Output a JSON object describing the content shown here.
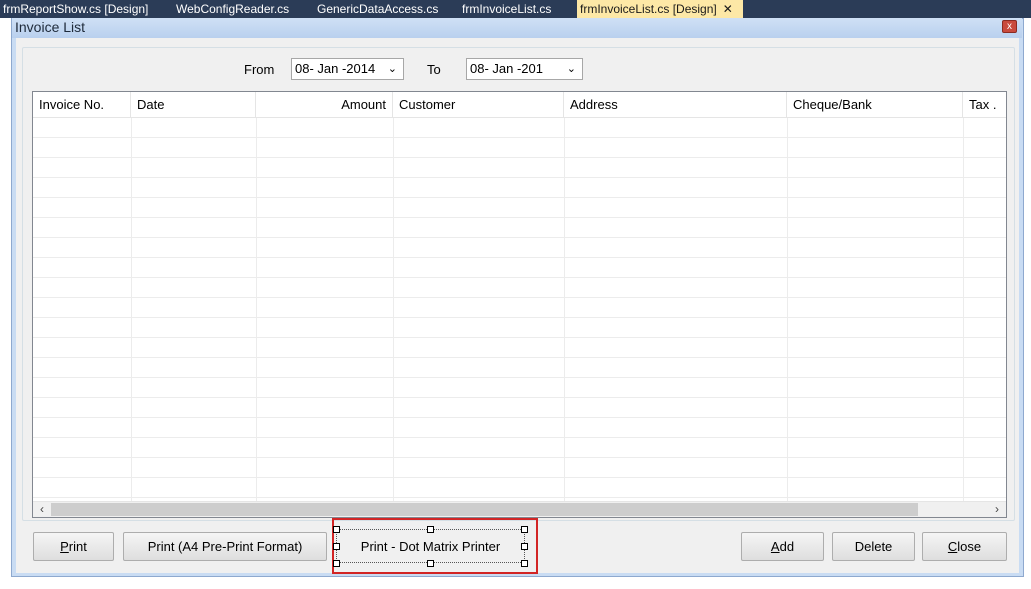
{
  "tabs": [
    {
      "label": "frmReportShow.cs [Design]",
      "active": false
    },
    {
      "label": "WebConfigReader.cs",
      "active": false
    },
    {
      "label": "GenericDataAccess.cs",
      "active": false
    },
    {
      "label": "frmInvoiceList.cs",
      "active": false
    },
    {
      "label": "frmInvoiceList.cs [Design]",
      "active": true,
      "close": "✕"
    }
  ],
  "window": {
    "title": "Invoice List",
    "close_glyph": "x"
  },
  "filters": {
    "from_label": "From",
    "from_value": "08- Jan -2014",
    "to_label": "To",
    "to_value": "08- Jan -201",
    "dropdown_glyph": "⌄"
  },
  "grid": {
    "columns": [
      "Invoice No.",
      "Date",
      "Amount",
      "Customer",
      "Address",
      "Cheque/Bank",
      "Tax ."
    ],
    "scroll_left": "‹",
    "scroll_right": "›"
  },
  "buttons": {
    "print": {
      "mnemonic": "P",
      "rest": "rint"
    },
    "print_a4": "Print (A4 Pre-Print Format)",
    "print_dot_matrix": "Print - Dot Matrix Printer",
    "add": {
      "mnemonic": "A",
      "rest": "dd"
    },
    "delete": "Delete",
    "close": {
      "mnemonic": "C",
      "rest": "lose"
    }
  },
  "colors": {
    "tabbar": "#2b3c57",
    "active_tab": "#fde8a6",
    "highlight_frame": "#d22525",
    "window_border": "#8ea9cf"
  }
}
